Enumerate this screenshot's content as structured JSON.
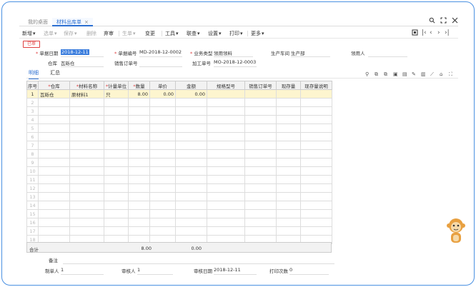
{
  "tabs": [
    {
      "label": "我的桌面"
    },
    {
      "label": "材料出库单"
    }
  ],
  "tab_close": "×",
  "window_icons": [
    "search-icon",
    "window-restore-icon",
    "fullscreen-icon",
    "close-icon"
  ],
  "toolbar": {
    "items": [
      {
        "label": "新增",
        "arrow": "▾",
        "disabled": false
      },
      {
        "label": "选单",
        "arrow": "▾",
        "disabled": true
      },
      {
        "label": "保存",
        "arrow": "▾",
        "disabled": true
      },
      {
        "label": "删除",
        "arrow": "",
        "disabled": true
      },
      {
        "label": "弃审",
        "arrow": "",
        "disabled": false
      },
      {
        "label": "生单",
        "arrow": "▾",
        "disabled": true
      },
      {
        "label": "变更",
        "arrow": "",
        "disabled": false
      },
      {
        "label": "工具",
        "arrow": "▾",
        "disabled": false
      },
      {
        "label": "联查",
        "arrow": "▾",
        "disabled": false
      },
      {
        "label": "设置",
        "arrow": "▾",
        "disabled": false
      },
      {
        "label": "打印",
        "arrow": "▾",
        "disabled": false
      },
      {
        "label": "更多",
        "arrow": "▾",
        "disabled": false
      }
    ]
  },
  "status_badge": "已审",
  "form": {
    "date_label": "单据日期",
    "date_value": "2018-12-11",
    "doc_no_label": "单据编号",
    "doc_no_value": "MD-2018-12-0002",
    "biz_type_label": "业务类型",
    "biz_type_value": "领用领料",
    "workshop_label": "生产车间",
    "workshop_value": "生产部",
    "receiver_label": "领用人",
    "receiver_value": "",
    "warehouse_label": "仓库",
    "warehouse_value": "瓦砾仓",
    "sales_order_label": "销售订单号",
    "sales_order_value": "",
    "process_order_label": "加工单号",
    "process_order_value": "MO-2018-12-0003"
  },
  "subtabs": [
    {
      "label": "明细"
    },
    {
      "label": "汇总"
    }
  ],
  "grid": {
    "headers": [
      {
        "label": "序号",
        "req": false
      },
      {
        "label": "仓库",
        "req": true
      },
      {
        "label": "材料名称",
        "req": true
      },
      {
        "label": "计量单位",
        "req": true
      },
      {
        "label": "数量",
        "req": true
      },
      {
        "label": "单价",
        "req": false
      },
      {
        "label": "金额",
        "req": false
      },
      {
        "label": "规格型号",
        "req": false
      },
      {
        "label": "销售订单号",
        "req": false
      },
      {
        "label": "现存量",
        "req": false
      },
      {
        "label": "现存量说明",
        "req": false
      }
    ],
    "rows": [
      {
        "no": "1",
        "warehouse": "瓦砾仓",
        "material": "原材料1",
        "unit": "只",
        "qty": "8.00",
        "price": "0.00",
        "amount": "0.00",
        "spec": "",
        "sales_order": "",
        "stock": "",
        "stock_note": ""
      }
    ],
    "empty_row_numbers": [
      "2",
      "3",
      "4",
      "5",
      "6",
      "7",
      "8",
      "9",
      "10",
      "11",
      "12",
      "13",
      "14",
      "15",
      "16",
      "17",
      "18"
    ]
  },
  "totals": {
    "label": "合计",
    "qty": "8.00",
    "amount": "0.00"
  },
  "footer": {
    "remark_label": "备注",
    "remark_value": "",
    "maker_label": "制单人",
    "maker_value": "1",
    "auditor_label": "审核人",
    "auditor_value": "1",
    "audit_date_label": "审核日期",
    "audit_date_value": "2018-12-11",
    "print_count_label": "打印次数",
    "print_count_value": "0"
  }
}
